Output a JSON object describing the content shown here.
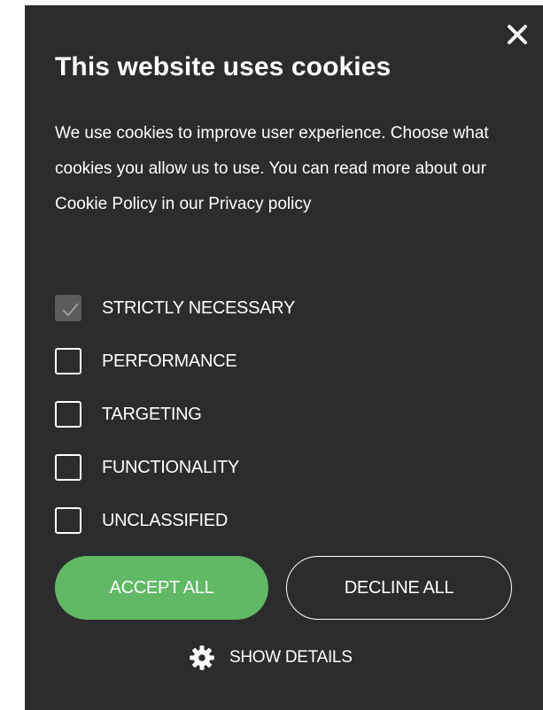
{
  "dialog": {
    "title": "This website uses cookies",
    "description": "We use cookies to improve user experience. Choose what cookies you allow us to use. You can read more about our Cookie Policy in our",
    "privacy_link": "Privacy policy",
    "close_icon": "close-icon"
  },
  "options": [
    {
      "label": "STRICTLY NECESSARY",
      "checked": true,
      "disabled": true
    },
    {
      "label": "PERFORMANCE",
      "checked": false
    },
    {
      "label": "TARGETING",
      "checked": false
    },
    {
      "label": "FUNCTIONALITY",
      "checked": false
    },
    {
      "label": "UNCLASSIFIED",
      "checked": false
    }
  ],
  "buttons": {
    "accept_label": "ACCEPT ALL",
    "decline_label": "DECLINE ALL"
  },
  "details": {
    "label": "SHOW DETAILS",
    "icon": "gear-icon"
  },
  "colors": {
    "background": "#2c2c2c",
    "accept": "#61b865",
    "checked_box": "#5c5c5c",
    "text": "#ffffff"
  }
}
